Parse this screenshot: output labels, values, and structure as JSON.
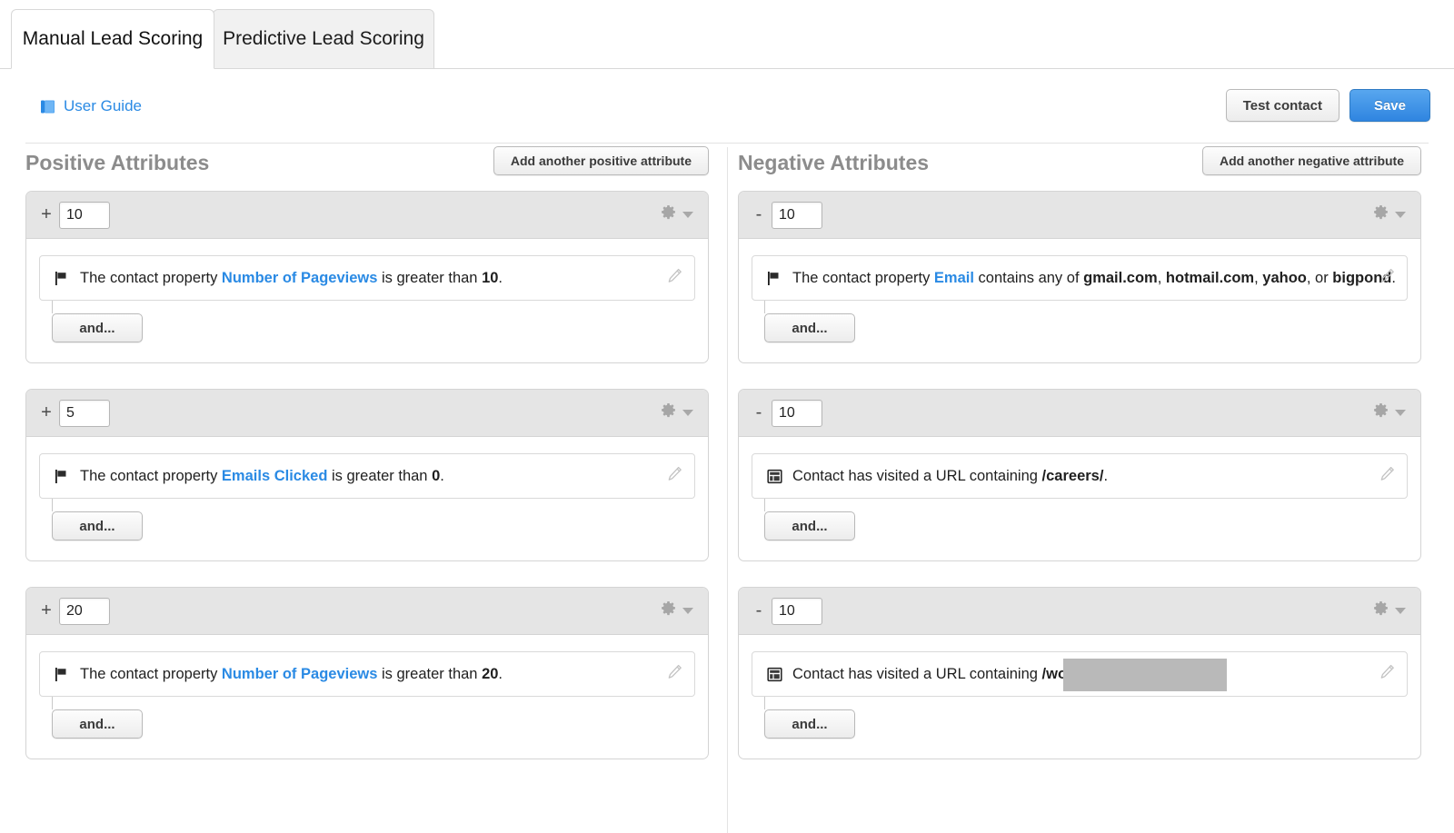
{
  "tabs": [
    {
      "label": "Manual Lead Scoring",
      "active": true
    },
    {
      "label": "Predictive Lead Scoring",
      "active": false
    }
  ],
  "header": {
    "user_guide_label": "User Guide",
    "user_guide_icon": "book-icon",
    "test_contact_label": "Test contact",
    "save_label": "Save",
    "accent_blue": "#2a8ae4",
    "save_button_blue": "#2f85e0"
  },
  "columns": {
    "positive": {
      "title": "Positive Attributes",
      "add_label": "Add another positive attribute",
      "sign": "+",
      "cards": [
        {
          "points": "10",
          "gear_icon": "gear-icon",
          "and_label": "and...",
          "condition": {
            "icon": "flag-icon",
            "edit_icon": "pencil-icon",
            "prefix": "The contact property ",
            "property": "Number of Pageviews",
            "middle": " is greater than ",
            "value": "10",
            "suffix": "."
          }
        },
        {
          "points": "5",
          "gear_icon": "gear-icon",
          "and_label": "and...",
          "condition": {
            "icon": "flag-icon",
            "edit_icon": "pencil-icon",
            "prefix": "The contact property ",
            "property": "Emails Clicked",
            "middle": " is greater than ",
            "value": "0",
            "suffix": "."
          }
        },
        {
          "points": "20",
          "gear_icon": "gear-icon",
          "and_label": "and...",
          "condition": {
            "icon": "flag-icon",
            "edit_icon": "pencil-icon",
            "prefix": "The contact property ",
            "property": "Number of Pageviews",
            "middle": " is greater than ",
            "value": "20",
            "suffix": "."
          }
        }
      ]
    },
    "negative": {
      "title": "Negative Attributes",
      "add_label": "Add another negative attribute",
      "sign": "-",
      "cards": [
        {
          "points": "10",
          "gear_icon": "gear-icon",
          "and_label": "and...",
          "condition": {
            "icon": "flag-icon",
            "edit_icon": "pencil-icon",
            "prefix": "The contact property ",
            "property": "Email",
            "middle": " contains any of ",
            "value": "gmail.com",
            "value2": "hotmail.com",
            "value3": "yahoo",
            "value4": "bigpond",
            "sep1": ", ",
            "sep2": ", ",
            "sep3": ", or ",
            "suffix": "."
          }
        },
        {
          "points": "10",
          "gear_icon": "gear-icon",
          "and_label": "and...",
          "condition": {
            "icon": "url-icon",
            "edit_icon": "pencil-icon",
            "prefix": "Contact has visited a URL containing ",
            "value": "/careers/",
            "suffix": "."
          }
        },
        {
          "points": "10",
          "gear_icon": "gear-icon",
          "and_label": "and...",
          "condition": {
            "icon": "url-icon",
            "edit_icon": "pencil-icon",
            "prefix": "Contact has visited a URL containing ",
            "value": "/wo",
            "redacted": true,
            "suffix": ""
          }
        }
      ]
    }
  }
}
